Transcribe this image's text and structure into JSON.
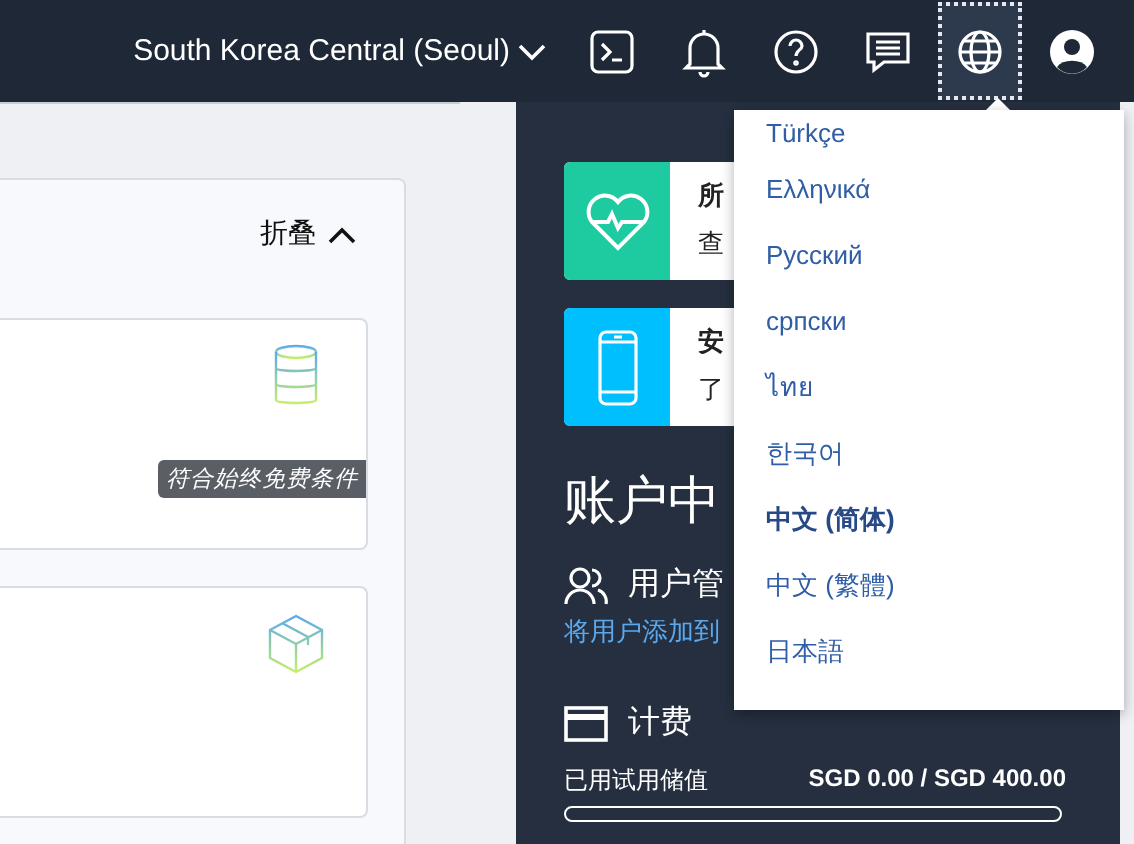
{
  "header": {
    "region": "South Korea Central (Seoul)",
    "icons": [
      {
        "kind": "terminal",
        "selected": false
      },
      {
        "kind": "bell",
        "selected": false
      },
      {
        "kind": "help",
        "selected": false
      },
      {
        "kind": "chat",
        "selected": false
      },
      {
        "kind": "globe",
        "selected": true
      },
      {
        "kind": "avatar",
        "selected": false
      }
    ]
  },
  "left_panel": {
    "collapse": "折叠",
    "cards": [
      {
        "kind": "database",
        "badge": "符合始终免费条件"
      },
      {
        "kind": "box"
      }
    ]
  },
  "right_panel": {
    "tiles": [
      {
        "kind": "health",
        "color": "#1ecaa0",
        "title": "所",
        "subtitle": "查"
      },
      {
        "kind": "phone",
        "color": "#00bfff",
        "title": "安",
        "subtitle": "了"
      }
    ],
    "account_title": "账户中",
    "user_management": {
      "title": "用户管",
      "link": "将用户添加到"
    },
    "billing": {
      "title": "计费",
      "label": "已用试用储值",
      "amount": "SGD 0.00 / SGD 400.00",
      "level": 0
    }
  },
  "language_menu": [
    {
      "label": "Türkçe",
      "selected": false
    },
    {
      "label": "Ελληνικά",
      "selected": false
    },
    {
      "label": "Русский",
      "selected": false
    },
    {
      "label": "српски",
      "selected": false
    },
    {
      "label": "ไทย",
      "selected": false
    },
    {
      "label": "한국어",
      "selected": false
    },
    {
      "label": "中文 (简体)",
      "selected": true
    },
    {
      "label": "中文 (繁體)",
      "selected": false
    },
    {
      "label": "日本語",
      "selected": false
    }
  ]
}
